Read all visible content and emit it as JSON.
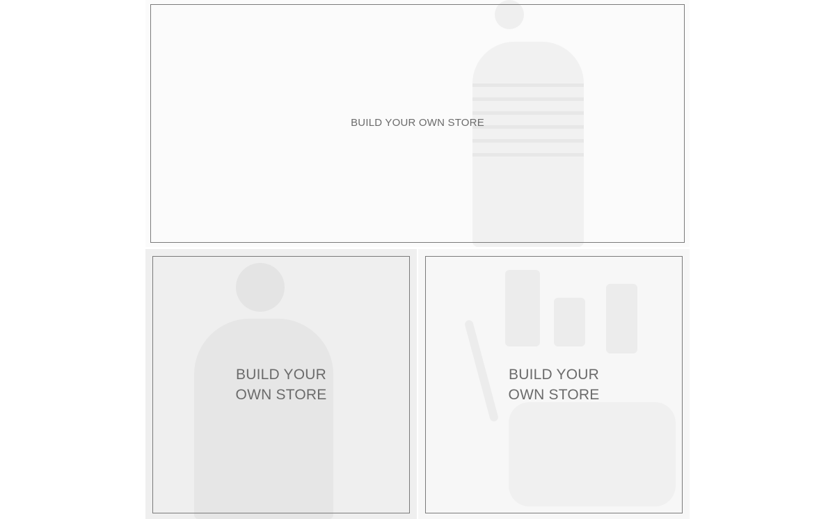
{
  "tiles": {
    "hero": {
      "label": "BUILD YOUR OWN STORE"
    },
    "left": {
      "label_line1": "BUILD YOUR",
      "label_line2": "OWN STORE"
    },
    "right": {
      "label_line1": "BUILD YOUR",
      "label_line2": "OWN STORE"
    }
  },
  "colors": {
    "frame": "#7a7a7a",
    "label": "#6b6b6b",
    "hero_bg": "#fbfbfb",
    "left_bg": "#efefef",
    "right_bg": "#f7f7f7"
  },
  "images": {
    "hero": "man-striped-sweater-photo",
    "left": "man-cap-sweater-photo",
    "right": "cosmetics-bag-photo"
  }
}
